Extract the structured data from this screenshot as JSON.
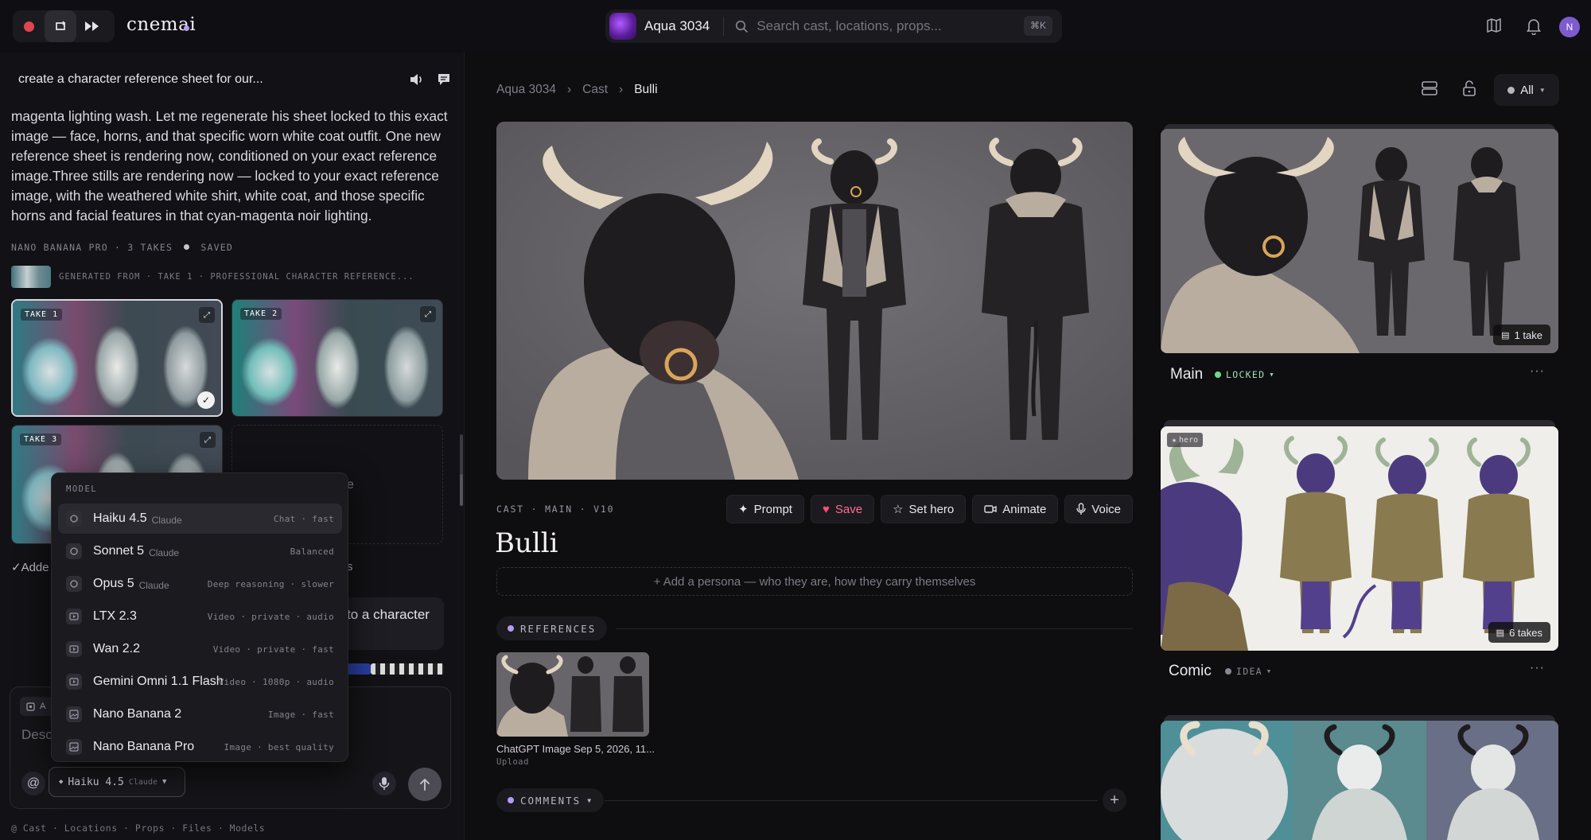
{
  "app": {
    "brand": "cnemai",
    "project_name": "Aqua 3034",
    "search_placeholder": "Search cast, locations, props...",
    "search_shortcut": "⌘K",
    "user_initial": "N"
  },
  "chat": {
    "title": "create a character reference sheet for our...",
    "message": "magenta lighting wash. Let me regenerate his sheet locked to this exact image — face, horns, and that specific worn white coat outfit. One new reference sheet is rendering now, conditioned on your exact reference image.Three stills are rendering now — locked to your exact reference image, with the weathered white shirt, white coat, and those specific horns and facial features in that cyan-magenta noir lighting.",
    "gen_meta": "NANO BANANA PRO · 3 TAKES",
    "gen_status": "SAVED",
    "gen_from": "GENERATED FROM · TAKE 1 · PROFESSIONAL CHARACTER REFERENCE...",
    "takes": [
      "TAKE 1",
      "TAKE 2",
      "TAKE 3"
    ],
    "added_text": "✓Adde",
    "added_tail": "s",
    "partial_right": "e",
    "bubble_text": "to a character",
    "composer_chip": "A",
    "composer_placeholder": "Desc",
    "at_label": "@",
    "selected_model": "Haiku 4.5",
    "selected_model_sub": "Claude",
    "footer_links": "@ Cast · Locations · Props · Files · Models"
  },
  "model_menu": {
    "title": "MODEL",
    "items": [
      {
        "name": "Haiku 4.5",
        "sub": "Claude",
        "tags": "Chat · fast",
        "icon": "chat-icon"
      },
      {
        "name": "Sonnet 5",
        "sub": "Claude",
        "tags": "Balanced",
        "icon": "chat-icon"
      },
      {
        "name": "Opus 5",
        "sub": "Claude",
        "tags": "Deep reasoning · slower",
        "icon": "chat-icon"
      },
      {
        "name": "LTX 2.3",
        "sub": "",
        "tags": "Video · private · audio",
        "icon": "video-icon"
      },
      {
        "name": "Wan 2.2",
        "sub": "",
        "tags": "Video · private · fast",
        "icon": "video-icon"
      },
      {
        "name": "Gemini Omni 1.1 Flash",
        "sub": "",
        "tags": "Video · 1080p · audio",
        "icon": "video-icon"
      },
      {
        "name": "Nano Banana 2",
        "sub": "",
        "tags": "Image · fast",
        "icon": "image-icon"
      },
      {
        "name": "Nano Banana Pro",
        "sub": "",
        "tags": "Image · best quality",
        "icon": "image-icon"
      }
    ]
  },
  "detail": {
    "breadcrumb": [
      "Aqua 3034",
      "Cast",
      "Bulli"
    ],
    "filter_label": "All",
    "meta": "CAST · MAIN · V10",
    "actions": {
      "prompt": "Prompt",
      "save": "Save",
      "set_hero": "Set hero",
      "animate": "Animate",
      "voice": "Voice"
    },
    "name": "Bulli",
    "persona_placeholder": "+ Add a persona — who they are, how they carry themselves",
    "references_label": "REFERENCES",
    "reference": {
      "name": "ChatGPT Image Sep 5, 2026, 11...",
      "source": "Upload"
    },
    "comments_label": "COMMENTS"
  },
  "looks": [
    {
      "title": "Main",
      "status": "LOCKED",
      "takes": "1 take",
      "status_color": "#6fd98a"
    },
    {
      "title": "Comic",
      "status": "IDEA",
      "takes": "6 takes",
      "badge": "hero",
      "status_color": "#8a8792"
    }
  ],
  "colors": {
    "accent": "#b39cf2",
    "save": "#ff4d7a",
    "record": "#e0454f"
  }
}
